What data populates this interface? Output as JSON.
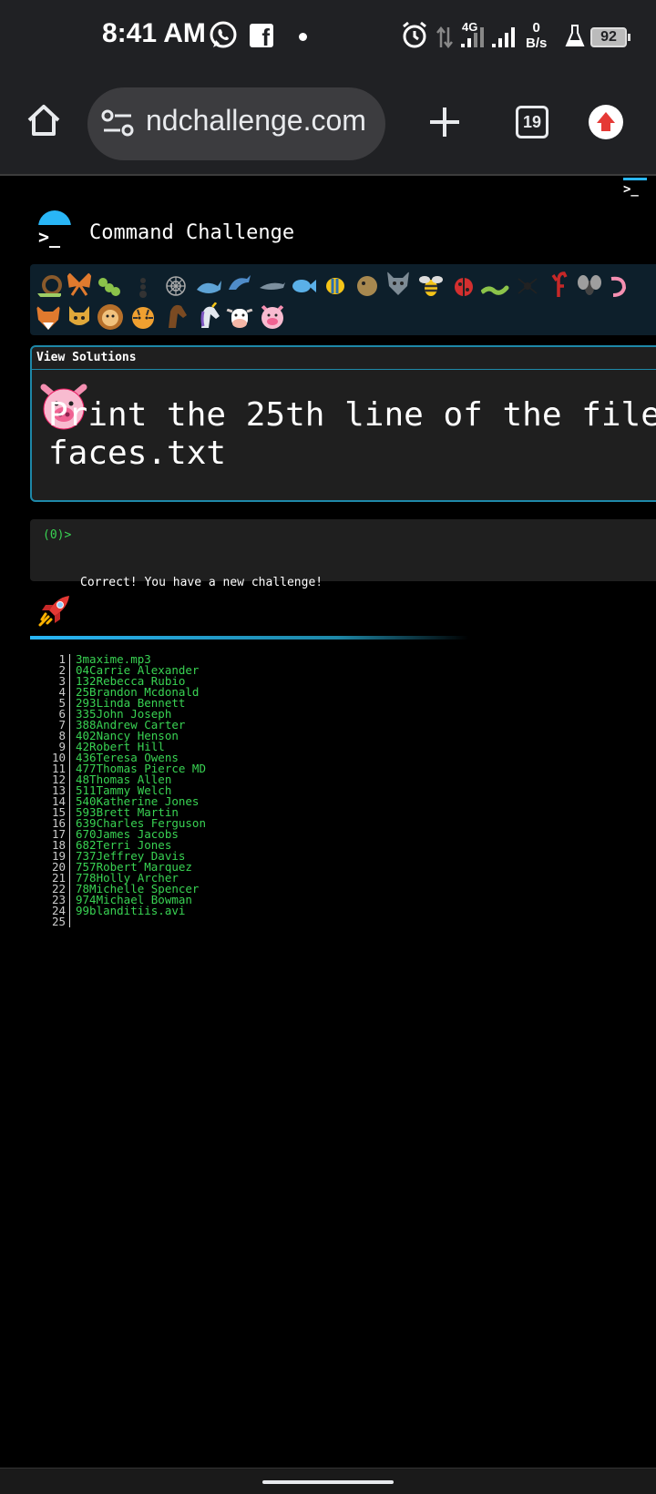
{
  "status_bar": {
    "time": "8:41 AM",
    "network_type": "4G",
    "net_speed_value": "0",
    "net_speed_unit": "B/s",
    "battery": "92",
    "icons": [
      "whatsapp-icon",
      "facebook-icon",
      "dot-icon",
      "alarm-icon",
      "data-arrows-icon",
      "signal-icon",
      "flask-icon",
      "battery-icon"
    ]
  },
  "browser": {
    "url": "ndchallenge.com",
    "tab_count": "19",
    "icons": [
      "home-icon",
      "site-info-icon",
      "plus-icon",
      "tabs-icon",
      "update-icon"
    ]
  },
  "page": {
    "title": "Command Challenge",
    "view_solutions": "View Solutions",
    "challenge_text": "Print the 25th line of the file\nfaces.txt",
    "prompt": "(0)>",
    "feedback": "Correct! You have a new challenge!",
    "progress_fraction": 0.7,
    "emoji_row1": [
      "snail",
      "butterfly",
      "caterpillar",
      "ant",
      "spider-web",
      "whale",
      "dolphin",
      "dolphin-2",
      "fish",
      "tropical-fish",
      "blowfish",
      "wolf",
      "bee",
      "ladybug",
      "worm",
      "spider",
      "scorpion",
      "fly",
      "shrimp"
    ],
    "emoji_row2": [
      "fox",
      "cat",
      "lion",
      "tiger",
      "horse",
      "unicorn",
      "cow",
      "pig"
    ],
    "output_lines": [
      {
        "n": "1",
        "text": "3maxime.mp3"
      },
      {
        "n": "2",
        "text": "04Carrie Alexander"
      },
      {
        "n": "3",
        "text": "132Rebecca Rubio"
      },
      {
        "n": "4",
        "text": "25Brandon Mcdonald"
      },
      {
        "n": "5",
        "text": "293Linda Bennett"
      },
      {
        "n": "6",
        "text": "335John Joseph"
      },
      {
        "n": "7",
        "text": "388Andrew Carter"
      },
      {
        "n": "8",
        "text": "402Nancy Henson"
      },
      {
        "n": "9",
        "text": "42Robert Hill"
      },
      {
        "n": "10",
        "text": "436Teresa Owens"
      },
      {
        "n": "11",
        "text": "477Thomas Pierce MD"
      },
      {
        "n": "12",
        "text": "48Thomas Allen"
      },
      {
        "n": "13",
        "text": "511Tammy Welch"
      },
      {
        "n": "14",
        "text": "540Katherine Jones"
      },
      {
        "n": "15",
        "text": "593Brett Martin"
      },
      {
        "n": "16",
        "text": "639Charles Ferguson"
      },
      {
        "n": "17",
        "text": "670James Jacobs"
      },
      {
        "n": "18",
        "text": "682Terri Jones"
      },
      {
        "n": "19",
        "text": "737Jeffrey Davis"
      },
      {
        "n": "20",
        "text": "757Robert Marquez"
      },
      {
        "n": "21",
        "text": "778Holly Archer"
      },
      {
        "n": "22",
        "text": "78Michelle Spencer"
      },
      {
        "n": "23",
        "text": "974Michael Bowman"
      },
      {
        "n": "24",
        "text": "99blanditiis.avi"
      },
      {
        "n": "25",
        "text": ""
      }
    ]
  },
  "colors": {
    "accent": "#29b6f6",
    "terminal_green": "#39d353",
    "panel_border": "#1e88a8",
    "chrome_bg": "#202124"
  }
}
